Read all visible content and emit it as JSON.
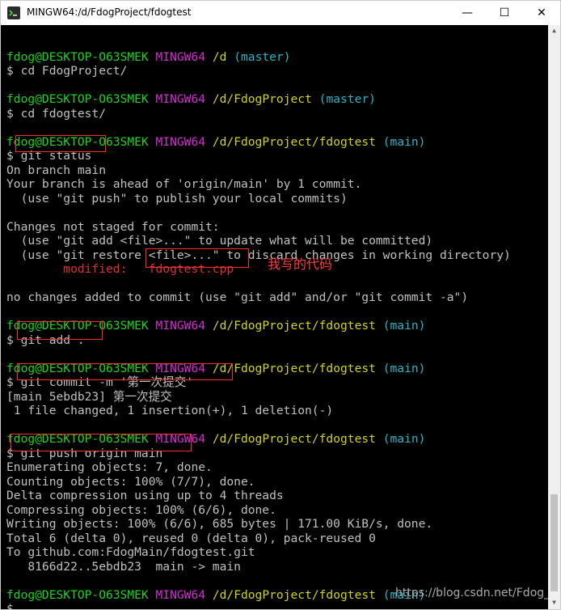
{
  "window": {
    "title": "MINGW64:/d/FdogProject/fdogtest",
    "minimize_glyph": "—",
    "maximize_glyph": "☐",
    "close_glyph": "✕"
  },
  "terminal": {
    "lines": [
      [],
      [
        [
          "c-user",
          "fdog@DESKTOP-O63SMEK"
        ],
        [
          "",
          "",
          " "
        ],
        [
          "c-sys",
          "MINGW64"
        ],
        [
          "",
          "",
          " "
        ],
        [
          "c-path",
          "/d"
        ],
        [
          "",
          "",
          " "
        ],
        [
          "c-branch",
          "(master)"
        ]
      ],
      [
        [
          "",
          "$ cd FdogProject/"
        ]
      ],
      [],
      [
        [
          "c-user",
          "fdog@DESKTOP-O63SMEK"
        ],
        [
          "",
          "",
          " "
        ],
        [
          "c-sys",
          "MINGW64"
        ],
        [
          "",
          "",
          " "
        ],
        [
          "c-path",
          "/d/FdogProject"
        ],
        [
          "",
          "",
          " "
        ],
        [
          "c-branch",
          "(master)"
        ]
      ],
      [
        [
          "",
          "$ cd fdogtest/"
        ]
      ],
      [],
      [
        [
          "c-user",
          "fdog@DESKTOP-O63SMEK"
        ],
        [
          "",
          "",
          " "
        ],
        [
          "c-sys",
          "MINGW64"
        ],
        [
          "",
          "",
          " "
        ],
        [
          "c-path",
          "/d/FdogProject/fdogtest"
        ],
        [
          "",
          "",
          " "
        ],
        [
          "c-branch",
          "(main)"
        ]
      ],
      [
        [
          "",
          "$ git status"
        ]
      ],
      [
        [
          "",
          "On branch main"
        ]
      ],
      [
        [
          "",
          "Your branch is ahead of 'origin/main' by 1 commit."
        ]
      ],
      [
        [
          "",
          "  (use \"git push\" to publish your local commits)"
        ]
      ],
      [],
      [
        [
          "",
          "Changes not staged for commit:"
        ]
      ],
      [
        [
          "",
          "  (use \"git add <file>...\" to update what will be committed)"
        ]
      ],
      [
        [
          "",
          "  (use \"git restore <file>...\" to discard changes in working directory)"
        ]
      ],
      [
        [
          "c-red",
          "        modified:   fdogtest.cpp"
        ]
      ],
      [],
      [
        [
          "",
          "no changes added to commit (use \"git add\" and/or \"git commit -a\")"
        ]
      ],
      [],
      [
        [
          "c-user",
          "fdog@DESKTOP-O63SMEK"
        ],
        [
          "",
          "",
          " "
        ],
        [
          "c-sys",
          "MINGW64"
        ],
        [
          "",
          "",
          " "
        ],
        [
          "c-path",
          "/d/FdogProject/fdogtest"
        ],
        [
          "",
          "",
          " "
        ],
        [
          "c-branch",
          "(main)"
        ]
      ],
      [
        [
          "",
          "$ git add ."
        ]
      ],
      [],
      [
        [
          "c-user",
          "fdog@DESKTOP-O63SMEK"
        ],
        [
          "",
          "",
          " "
        ],
        [
          "c-sys",
          "MINGW64"
        ],
        [
          "",
          "",
          " "
        ],
        [
          "c-path",
          "/d/FdogProject/fdogtest"
        ],
        [
          "",
          "",
          " "
        ],
        [
          "c-branch",
          "(main)"
        ]
      ],
      [
        [
          "",
          "$ git commit -m '第一次提交'"
        ]
      ],
      [
        [
          "",
          "[main 5ebdb23] 第一次提交"
        ]
      ],
      [
        [
          "",
          "",
          " 1 file changed, 1 insertion(+), 1 deletion(-)"
        ]
      ],
      [],
      [
        [
          "c-user",
          "fdog@DESKTOP-O63SMEK"
        ],
        [
          "",
          "",
          " "
        ],
        [
          "c-sys",
          "MINGW64"
        ],
        [
          "",
          "",
          " "
        ],
        [
          "c-path",
          "/d/FdogProject/fdogtest"
        ],
        [
          "",
          "",
          " "
        ],
        [
          "c-branch",
          "(main)"
        ]
      ],
      [
        [
          "",
          "$ git push origin main"
        ]
      ],
      [
        [
          "",
          "Enumerating objects: 7, done."
        ]
      ],
      [
        [
          "",
          "Counting objects: 100% (7/7), done."
        ]
      ],
      [
        [
          "",
          "Delta compression using up to 4 threads"
        ]
      ],
      [
        [
          "",
          "Compressing objects: 100% (6/6), done."
        ]
      ],
      [
        [
          "",
          "Writing objects: 100% (6/6), 685 bytes | 171.00 KiB/s, done."
        ]
      ],
      [
        [
          "",
          "Total 6 (delta 0), reused 0 (delta 0), pack-reused 0"
        ]
      ],
      [
        [
          "",
          "To github.com:FdogMain/fdogtest.git"
        ]
      ],
      [
        [
          "",
          "   8166d22..5ebdb23  main -> main"
        ]
      ],
      [],
      [
        [
          "c-user",
          "fdog@DESKTOP-O63SMEK"
        ],
        [
          "",
          "",
          " "
        ],
        [
          "c-sys",
          "MINGW64"
        ],
        [
          "",
          "",
          " "
        ],
        [
          "c-path",
          "/d/FdogProject/fdogtest"
        ],
        [
          "",
          "",
          " "
        ],
        [
          "c-branch",
          "(main)"
        ]
      ],
      [
        [
          "",
          "$"
        ]
      ]
    ]
  },
  "annotation": "我写的代码",
  "watermark": "https://blog.csdn.net/Fdog_"
}
